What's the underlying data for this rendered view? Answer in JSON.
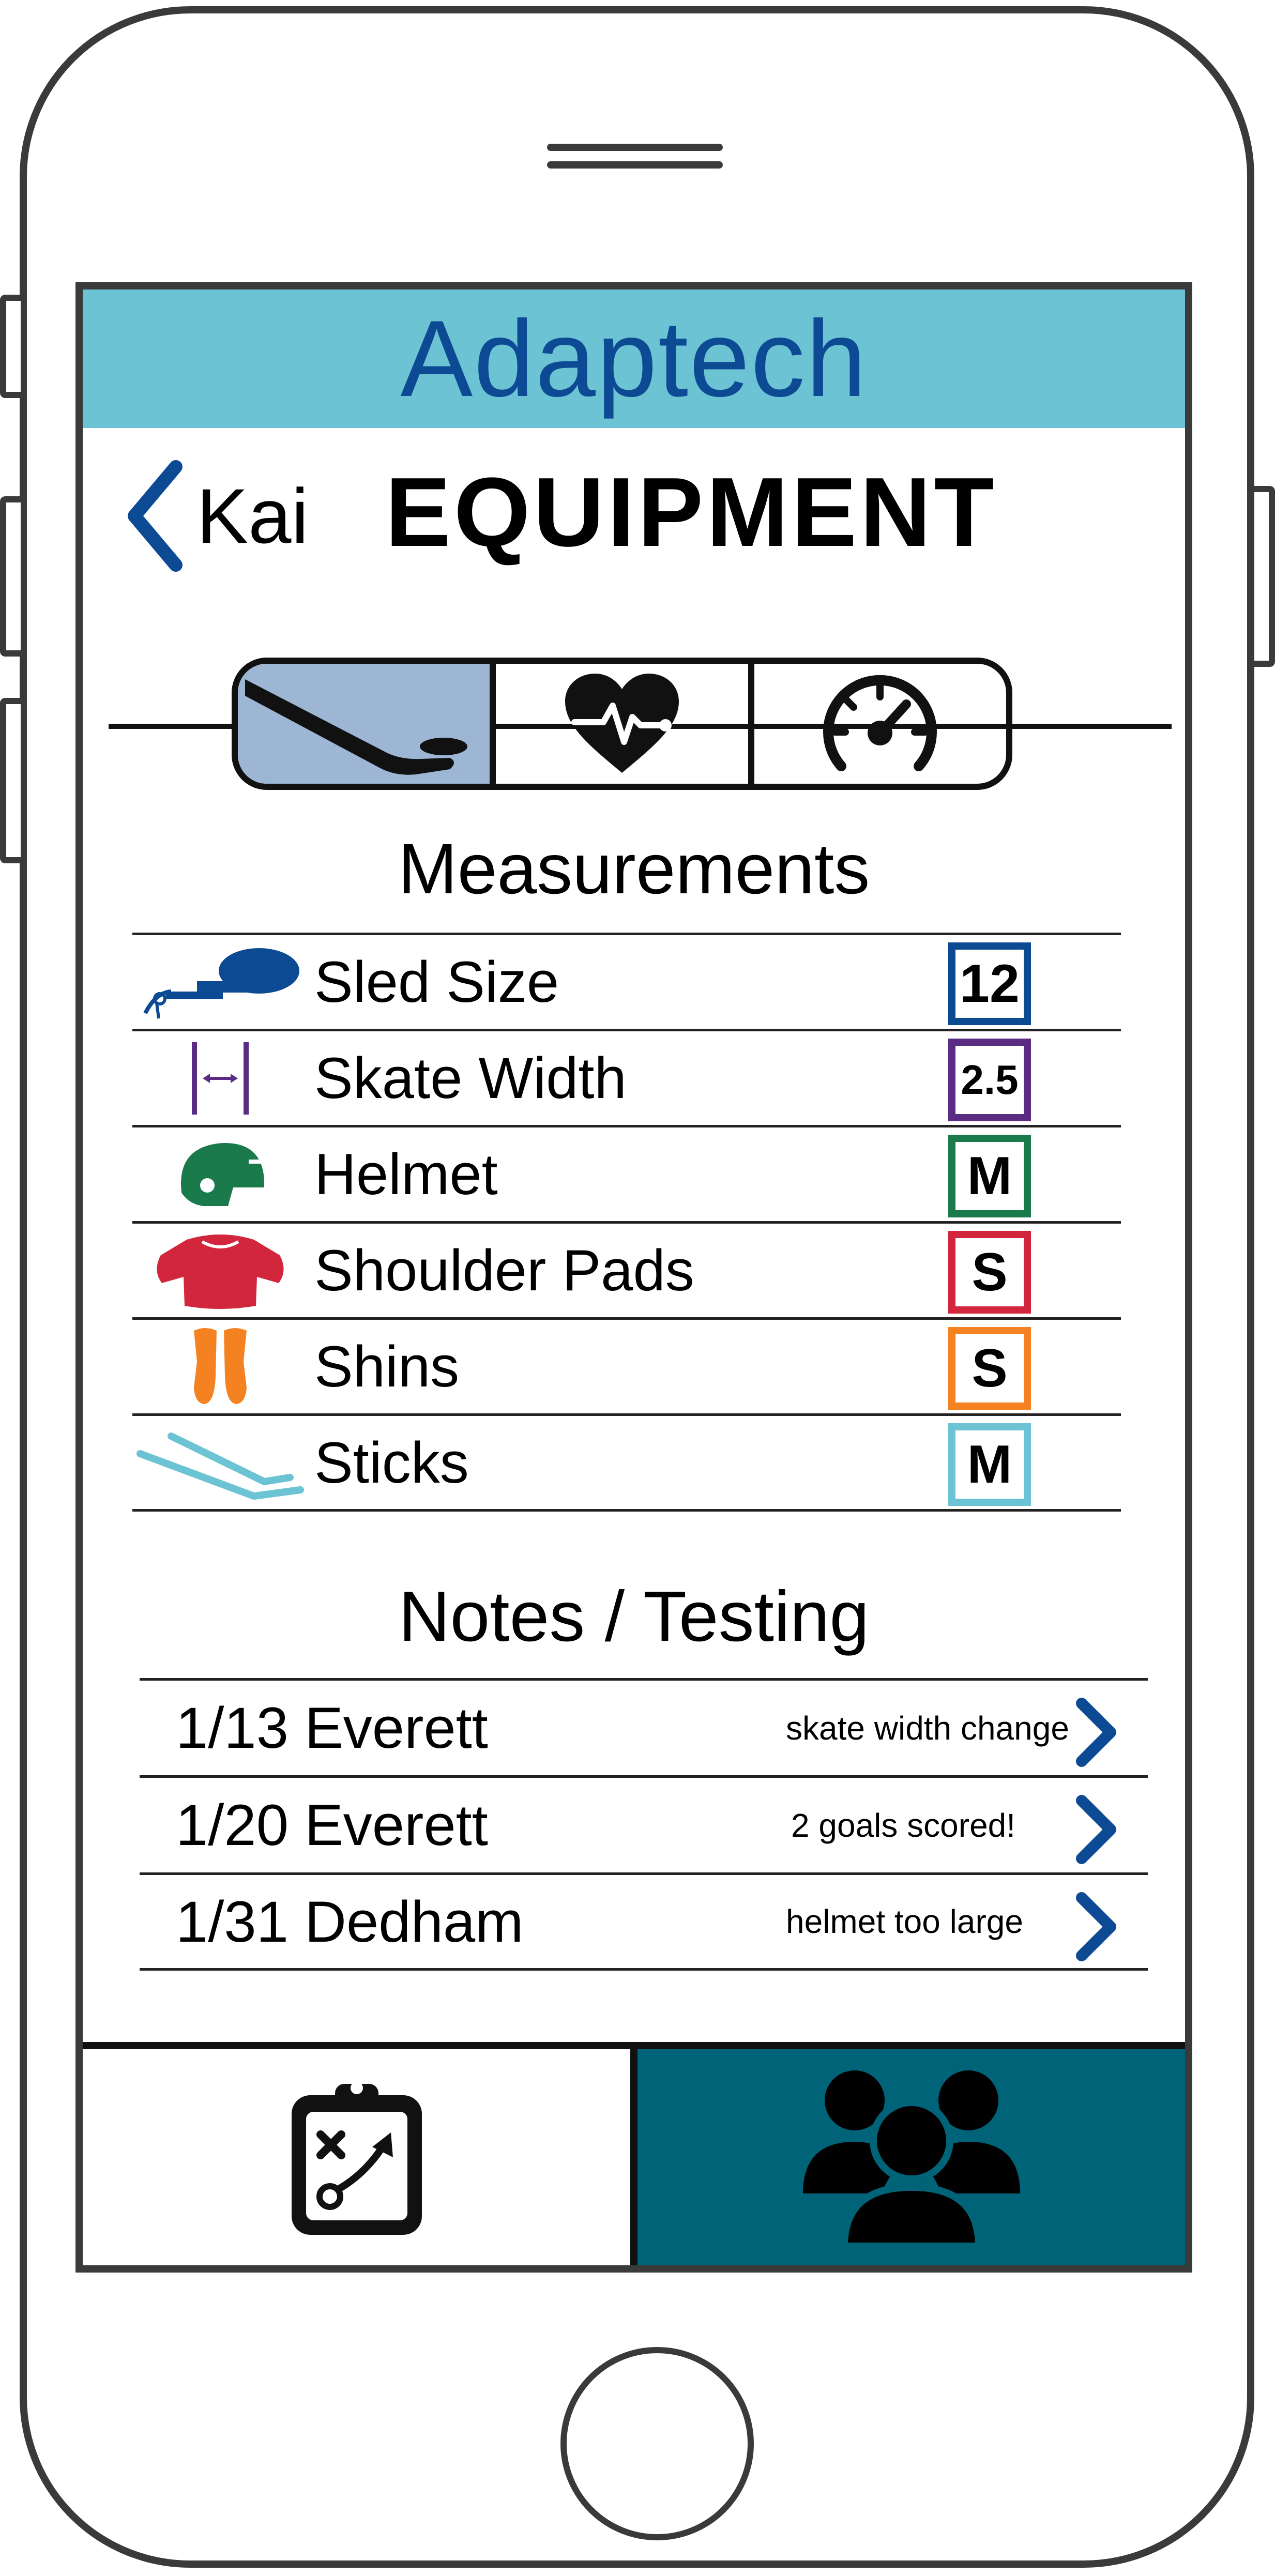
{
  "app": {
    "title": "Adaptech",
    "accent": "#6bc3d3",
    "brand": "#0d4a94"
  },
  "header": {
    "back_label": "Kai",
    "title": "EQUIPMENT"
  },
  "tabs": [
    {
      "icon": "hockey-stick-puck-icon",
      "active": true
    },
    {
      "icon": "heart-pulse-icon",
      "active": false
    },
    {
      "icon": "speedometer-icon",
      "active": false
    }
  ],
  "measurements": {
    "title": "Measurements",
    "items": [
      {
        "label": "Sled Size",
        "value": "12",
        "color": "#0d4a94",
        "icon": "sled-icon"
      },
      {
        "label": "Skate Width",
        "value": "2.5",
        "color": "#5b2c83",
        "icon": "width-arrows-icon"
      },
      {
        "label": "Helmet",
        "value": "M",
        "color": "#1a7a4c",
        "icon": "helmet-icon"
      },
      {
        "label": "Shoulder Pads",
        "value": "S",
        "color": "#d2263c",
        "icon": "shoulder-pads-icon"
      },
      {
        "label": "Shins",
        "value": "S",
        "color": "#f58220",
        "icon": "shin-guards-icon"
      },
      {
        "label": "Sticks",
        "value": "M",
        "color": "#6bc3d3",
        "icon": "sticks-icon"
      }
    ]
  },
  "notes": {
    "title": "Notes / Testing",
    "items": [
      {
        "date": "1/13 Everett",
        "note": "skate width change"
      },
      {
        "date": "1/20 Everett",
        "note": "2 goals scored!"
      },
      {
        "date": "1/31 Dedham",
        "note": "helmet too large"
      }
    ]
  },
  "bottom_nav": [
    {
      "icon": "clipboard-playbook-icon",
      "active": false
    },
    {
      "icon": "team-group-icon",
      "active": true,
      "color": "#006378"
    }
  ]
}
